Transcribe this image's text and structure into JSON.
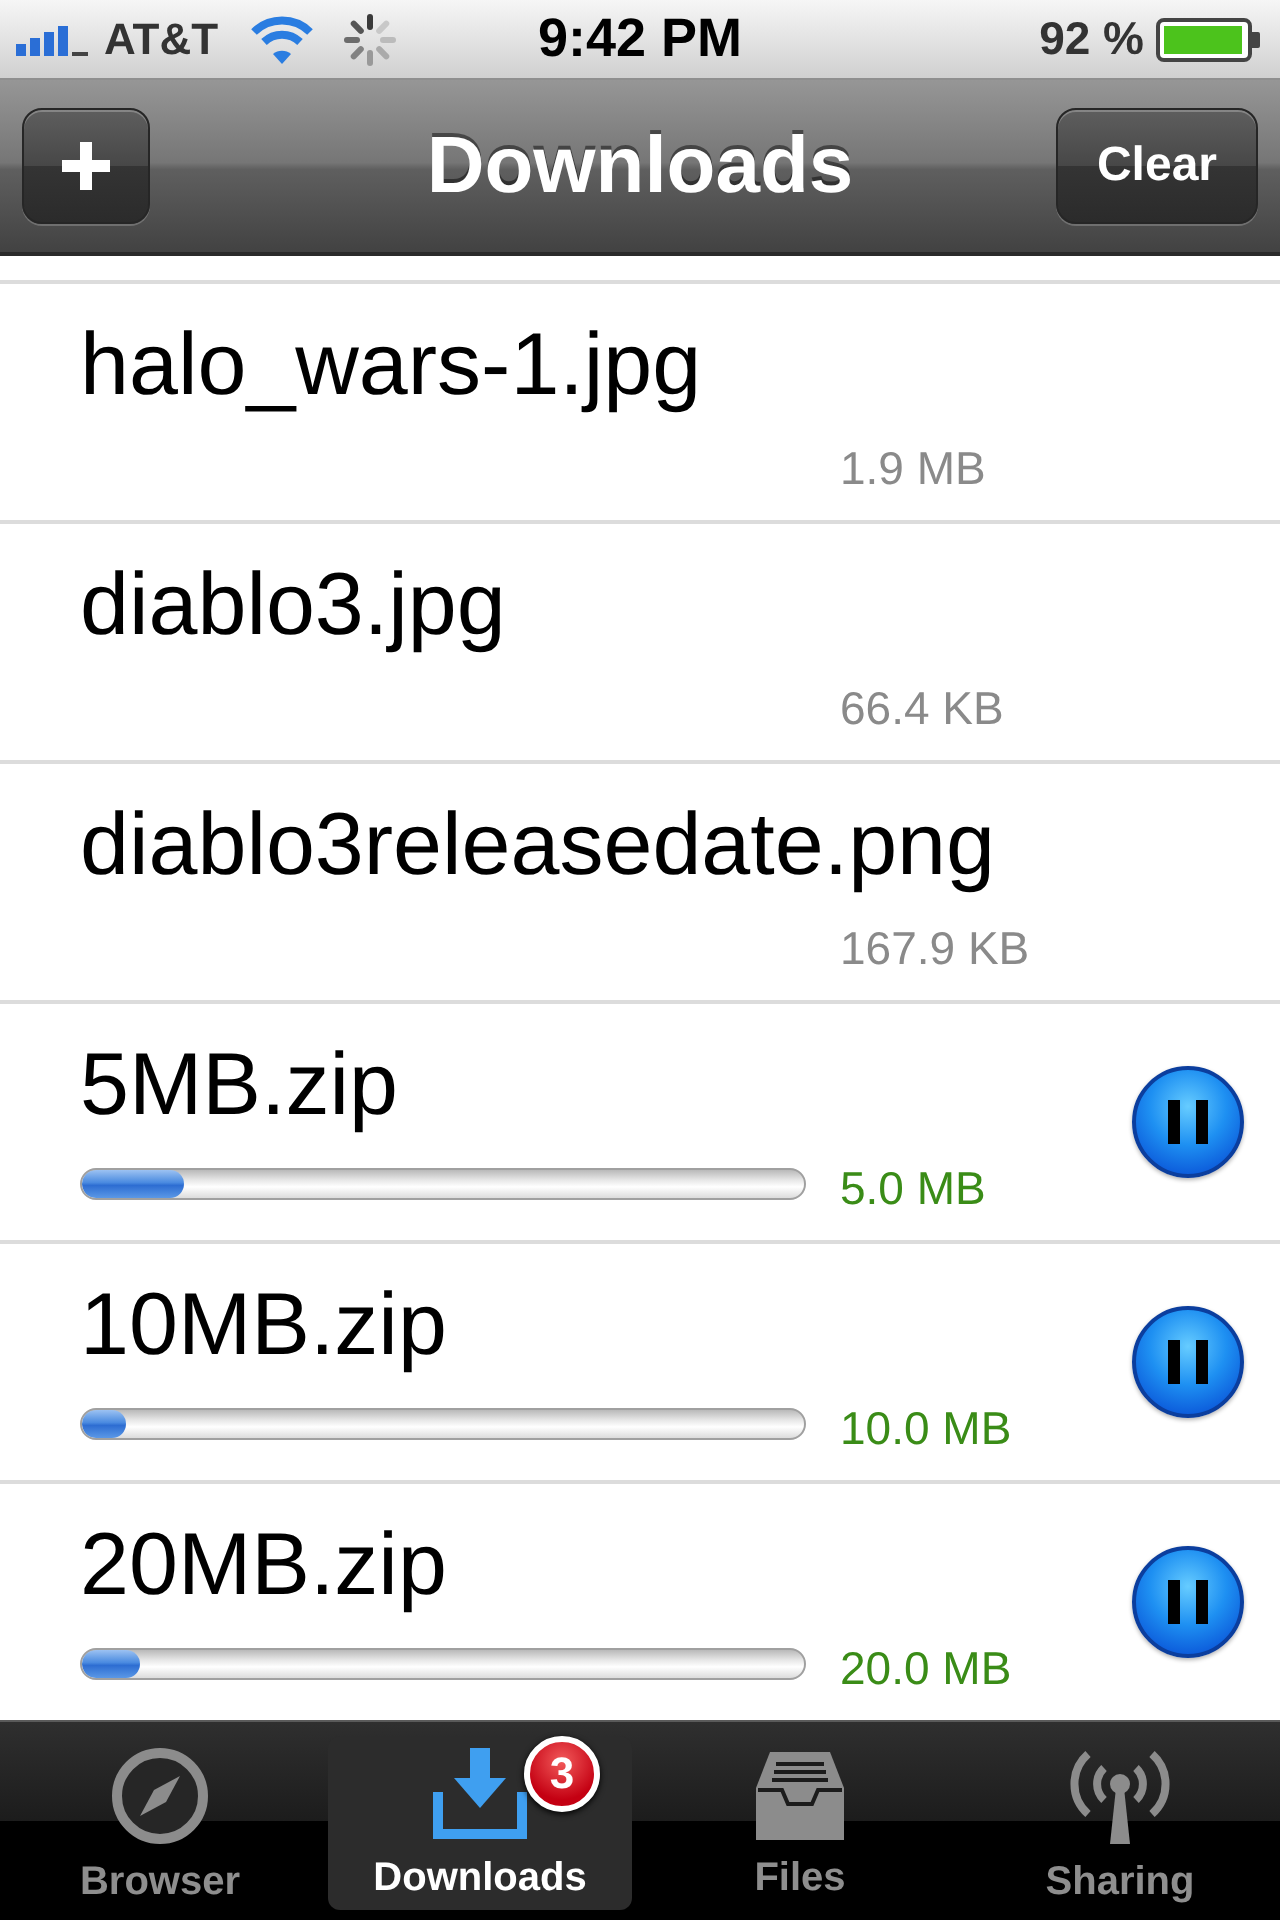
{
  "status_bar": {
    "carrier": "AT&T",
    "time": "9:42 PM",
    "battery_text": "92 %"
  },
  "nav_bar": {
    "title": "Downloads",
    "right_button": "Clear"
  },
  "downloads": [
    {
      "kind": "complete",
      "name": "halo_wars-1.jpg",
      "size": "1.9 MB"
    },
    {
      "kind": "complete",
      "name": "diablo3.jpg",
      "size": "66.4 KB"
    },
    {
      "kind": "complete",
      "name": "diablo3releasedate.png",
      "size": "167.9 KB"
    },
    {
      "kind": "downloading",
      "name": "5MB.zip",
      "size": "5.0 MB",
      "level": 0.14
    },
    {
      "kind": "downloading",
      "name": "10MB.zip",
      "size": "10.0 MB",
      "level": 0.06
    },
    {
      "kind": "downloading",
      "name": "20MB.zip",
      "size": "20.0 MB",
      "level": 0.08
    }
  ],
  "tab_bar": [
    {
      "label": "Browser",
      "selected": false
    },
    {
      "label": "Downloads",
      "selected": true,
      "badge": "3"
    },
    {
      "label": "Files",
      "selected": false
    },
    {
      "label": "Sharing",
      "selected": false
    }
  ]
}
